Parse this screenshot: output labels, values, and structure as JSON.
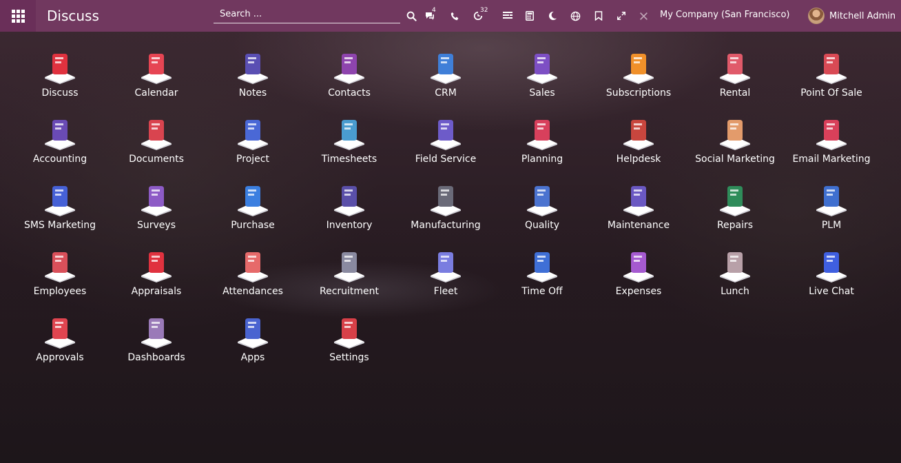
{
  "navbar": {
    "app_title": "Discuss",
    "search_placeholder": "Search ...",
    "messages_count": "4",
    "activities_count": "32",
    "company": "My Company (San Francisco)",
    "user_name": "Mitchell Admin"
  },
  "apps": [
    {
      "label": "Discuss",
      "icon": "discuss-icon",
      "color": "#e0323f"
    },
    {
      "label": "Calendar",
      "icon": "calendar-icon",
      "color": "#e64553"
    },
    {
      "label": "Notes",
      "icon": "notes-icon",
      "color": "#5a4fb3"
    },
    {
      "label": "Contacts",
      "icon": "contacts-icon",
      "color": "#8e44ad"
    },
    {
      "label": "CRM",
      "icon": "crm-icon",
      "color": "#3f7fd8"
    },
    {
      "label": "Sales",
      "icon": "sales-icon",
      "color": "#7d4fc4"
    },
    {
      "label": "Subscriptions",
      "icon": "subscriptions-icon",
      "color": "#f0902a"
    },
    {
      "label": "Rental",
      "icon": "rental-icon",
      "color": "#e05a6a"
    },
    {
      "label": "Point Of Sale",
      "icon": "point-of-sale-icon",
      "color": "#d94a55"
    },
    {
      "label": "Accounting",
      "icon": "accounting-icon",
      "color": "#6a4bb5"
    },
    {
      "label": "Documents",
      "icon": "documents-icon",
      "color": "#d9444f"
    },
    {
      "label": "Project",
      "icon": "project-icon",
      "color": "#4a68d6"
    },
    {
      "label": "Timesheets",
      "icon": "timesheets-icon",
      "color": "#4a9ccf"
    },
    {
      "label": "Field Service",
      "icon": "field-service-icon",
      "color": "#6d5bc9"
    },
    {
      "label": "Planning",
      "icon": "planning-icon",
      "color": "#d8405c"
    },
    {
      "label": "Helpdesk",
      "icon": "helpdesk-icon",
      "color": "#c8463e"
    },
    {
      "label": "Social Marketing",
      "icon": "social-marketing-icon",
      "color": "#e39b6b"
    },
    {
      "label": "Email Marketing",
      "icon": "email-marketing-icon",
      "color": "#d9405a"
    },
    {
      "label": "SMS Marketing",
      "icon": "sms-marketing-icon",
      "color": "#4661d6"
    },
    {
      "label": "Surveys",
      "icon": "surveys-icon",
      "color": "#8d5bc6"
    },
    {
      "label": "Purchase",
      "icon": "purchase-icon",
      "color": "#3b7fe0"
    },
    {
      "label": "Inventory",
      "icon": "inventory-icon",
      "color": "#5a4fa8"
    },
    {
      "label": "Manufacturing",
      "icon": "manufacturing-icon",
      "color": "#6a6a78"
    },
    {
      "label": "Quality",
      "icon": "quality-icon",
      "color": "#4b73d0"
    },
    {
      "label": "Maintenance",
      "icon": "maintenance-icon",
      "color": "#6a58c2"
    },
    {
      "label": "Repairs",
      "icon": "repairs-icon",
      "color": "#2f8c5a"
    },
    {
      "label": "PLM",
      "icon": "plm-icon",
      "color": "#3f6fcf"
    },
    {
      "label": "Employees",
      "icon": "employees-icon",
      "color": "#d9505a"
    },
    {
      "label": "Appraisals",
      "icon": "appraisals-icon",
      "color": "#e0323f"
    },
    {
      "label": "Attendances",
      "icon": "attendances-icon",
      "color": "#e66a6a"
    },
    {
      "label": "Recruitment",
      "icon": "recruitment-icon",
      "color": "#8a8aa0"
    },
    {
      "label": "Fleet",
      "icon": "fleet-icon",
      "color": "#7a7de0"
    },
    {
      "label": "Time Off",
      "icon": "time-off-icon",
      "color": "#3f6fd6"
    },
    {
      "label": "Expenses",
      "icon": "expenses-icon",
      "color": "#a55ad0"
    },
    {
      "label": "Lunch",
      "icon": "lunch-icon",
      "color": "#b8a0a8"
    },
    {
      "label": "Live Chat",
      "icon": "live-chat-icon",
      "color": "#3f5fe0"
    },
    {
      "label": "Approvals",
      "icon": "approvals-icon",
      "color": "#e04550"
    },
    {
      "label": "Dashboards",
      "icon": "dashboards-icon",
      "color": "#9a7ab8"
    },
    {
      "label": "Apps",
      "icon": "apps-icon",
      "color": "#4a64d0"
    },
    {
      "label": "Settings",
      "icon": "settings-icon",
      "color": "#d84048"
    }
  ]
}
